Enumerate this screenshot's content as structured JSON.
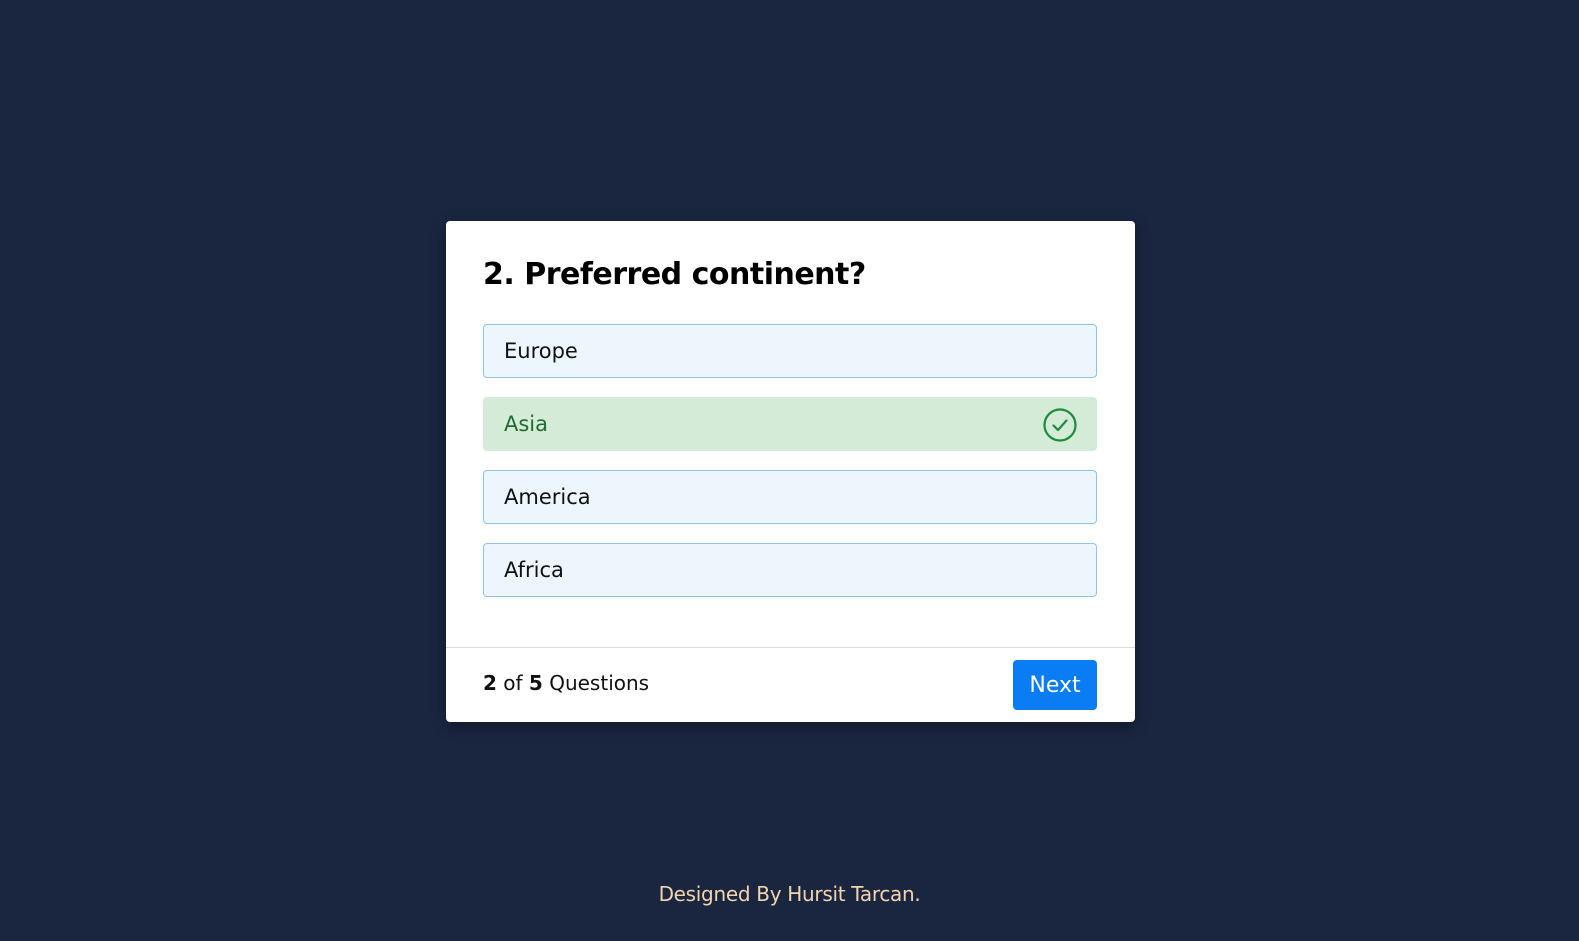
{
  "question": {
    "title": "2. Preferred continent?"
  },
  "options": [
    {
      "label": "Europe",
      "selected": false
    },
    {
      "label": "Asia",
      "selected": true
    },
    {
      "label": "America",
      "selected": false
    },
    {
      "label": "Africa",
      "selected": false
    }
  ],
  "progress": {
    "current": "2",
    "of": "of",
    "total": "5",
    "suffix": "Questions"
  },
  "next_button": {
    "label": "Next"
  },
  "credit": {
    "text": "Designed By Hursit Tarcan."
  },
  "colors": {
    "background": "#1a2540",
    "card": "#ffffff",
    "option_bg": "#eef6fd",
    "option_border": "#8fc3ee",
    "selected_bg": "#d4ecd7",
    "selected_text": "#1f6b34",
    "accent": "#0a7cf4",
    "credit_text": "#f2d5ad"
  },
  "icons": {
    "selected_option": "check-circle-icon"
  }
}
